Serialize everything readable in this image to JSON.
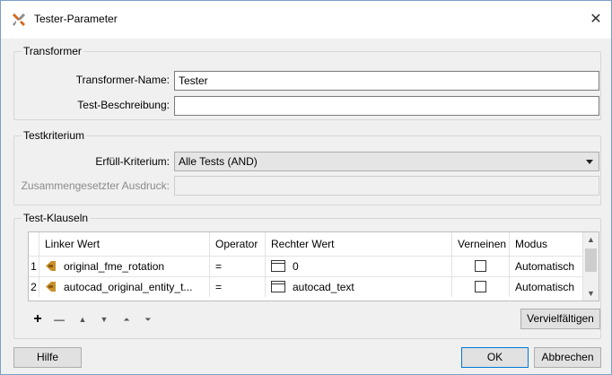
{
  "window": {
    "title": "Tester-Parameter",
    "close_glyph": "✕"
  },
  "transformer": {
    "group_title": "Transformer",
    "name_label": "Transformer-Name:",
    "name_value": "Tester",
    "desc_label": "Test-Beschreibung:",
    "desc_value": ""
  },
  "testkriterium": {
    "group_title": "Testkriterium",
    "criterion_label": "Erfüll-Kriterium:",
    "criterion_value": "Alle Tests (AND)",
    "composite_label": "Zusammengesetzter Ausdruck:",
    "composite_value": ""
  },
  "clauses": {
    "group_title": "Test-Klauseln",
    "columns": [
      "Linker Wert",
      "Operator",
      "Rechter Wert",
      "Verneinen",
      "Modus"
    ],
    "rows": [
      {
        "num": "1",
        "left": "original_fme_rotation",
        "operator": "=",
        "right": "0",
        "negate": false,
        "mode": "Automatisch"
      },
      {
        "num": "2",
        "left": "autocad_original_entity_t...",
        "operator": "=",
        "right": "autocad_text",
        "negate": false,
        "mode": "Automatisch"
      }
    ],
    "toolbar": {
      "add": "+",
      "remove": "—",
      "move_up": "▲",
      "move_down": "▼",
      "move_top": "⏶",
      "move_bottom": "⏷"
    },
    "duplicate_label": "Vervielfältigen"
  },
  "buttons": {
    "help": "Hilfe",
    "ok": "OK",
    "cancel": "Abbrechen"
  },
  "colors": {
    "accent": "#0078d7",
    "icon_attr": "#c8902a"
  }
}
